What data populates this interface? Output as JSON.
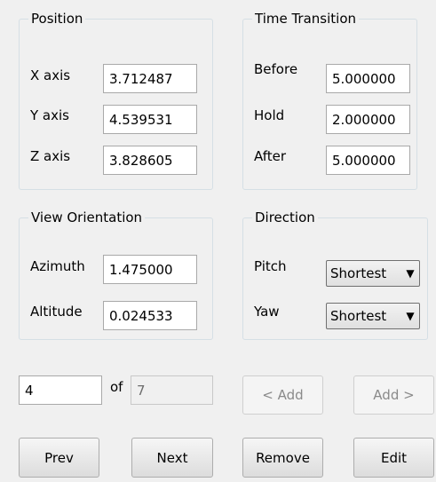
{
  "position": {
    "title": "Position",
    "x_label": "X axis",
    "x_value": "3.712487",
    "y_label": "Y axis",
    "y_value": "4.539531",
    "z_label": "Z axis",
    "z_value": "3.828605"
  },
  "time_transition": {
    "title": "Time Transition",
    "before_label": "Before",
    "before_value": "5.000000",
    "hold_label": "Hold",
    "hold_value": "2.000000",
    "after_label": "After",
    "after_value": "5.000000"
  },
  "view_orientation": {
    "title": "View Orientation",
    "azimuth_label": "Azimuth",
    "azimuth_value": "1.475000",
    "altitude_label": "Altitude",
    "altitude_value": "0.024533"
  },
  "direction": {
    "title": "Direction",
    "pitch_label": "Pitch",
    "pitch_value": "Shortest",
    "yaw_label": "Yaw",
    "yaw_value": "Shortest"
  },
  "navigation": {
    "current": "4",
    "of_label": "of",
    "total": "7",
    "add_before_label": "< Add",
    "add_after_label": "Add >"
  },
  "buttons": {
    "prev": "Prev",
    "next": "Next",
    "remove": "Remove",
    "edit": "Edit"
  },
  "icons": {
    "dropdown_arrow": "chevron-down-icon"
  }
}
